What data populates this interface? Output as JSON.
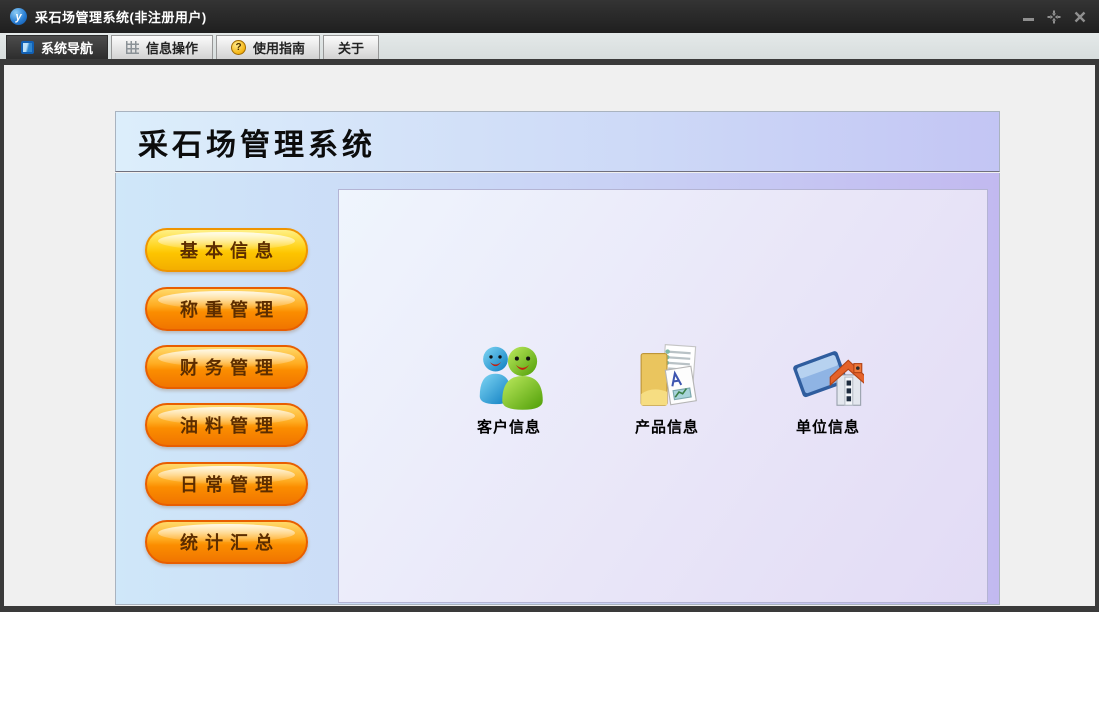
{
  "window": {
    "title": "采石场管理系统(非注册用户)",
    "app_icon_letter": "y"
  },
  "tabbar": {
    "tabs": [
      {
        "label": "系统导航",
        "active": true
      },
      {
        "label": "信息操作",
        "active": false
      },
      {
        "label": "使用指南",
        "active": false
      },
      {
        "label": "关于",
        "active": false
      }
    ],
    "help_icon_glyph": "?"
  },
  "main": {
    "heading": "采石场管理系统",
    "nav_buttons": [
      {
        "label": "基本信息",
        "state": "selected"
      },
      {
        "label": "称重管理",
        "state": "normal"
      },
      {
        "label": "财务管理",
        "state": "normal"
      },
      {
        "label": "油料管理",
        "state": "normal"
      },
      {
        "label": "日常管理",
        "state": "normal"
      },
      {
        "label": "统计汇总",
        "state": "normal"
      }
    ],
    "shortcuts": [
      {
        "label": "客户信息",
        "icon": "customers-icon"
      },
      {
        "label": "产品信息",
        "icon": "products-folder-icon"
      },
      {
        "label": "单位信息",
        "icon": "organization-building-icon"
      }
    ]
  },
  "colors": {
    "titlebar": "#262626",
    "tab_active": "#3a3a3a",
    "nav_button_orange": "#fb8d00",
    "nav_button_selected_yellow": "#ffcc00",
    "banner_start": "#dceefb",
    "banner_end": "#c3c5f4",
    "content_left": "#cfe7f9",
    "content_right": "#c2b9f0"
  }
}
